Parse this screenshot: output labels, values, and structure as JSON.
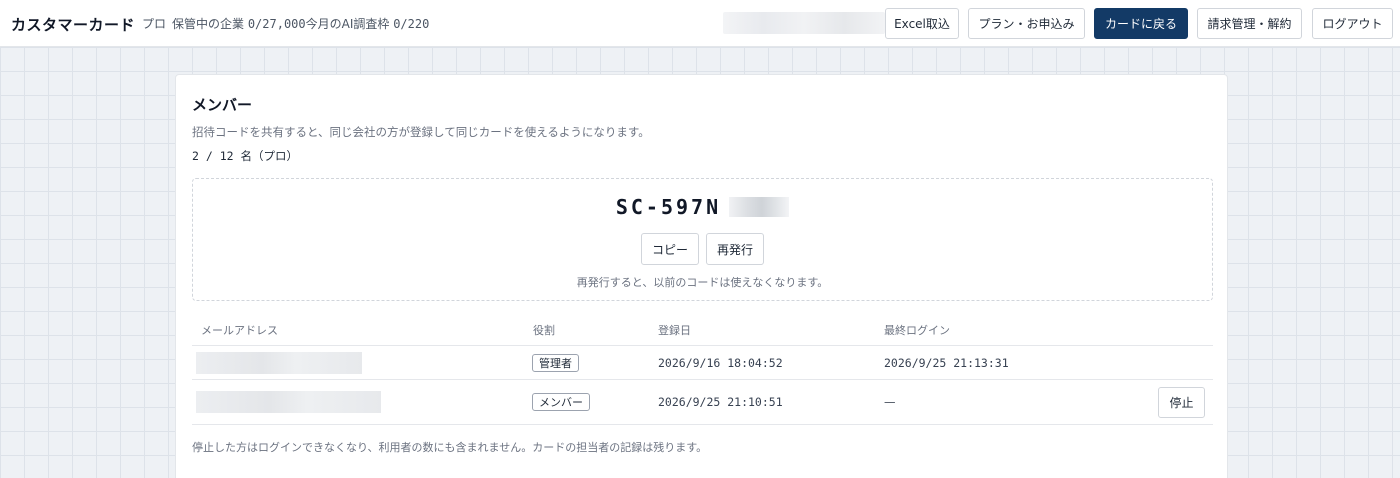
{
  "header": {
    "app_title": "カスタマーカード",
    "plan_label": "プロ",
    "usage_prefix": "保管中の企業 ",
    "usage_companies": "0/27,000",
    "usage_ai_label": "今月のAI調査枠 ",
    "usage_ai": "0/220",
    "buttons": {
      "excel_import": "Excel取込",
      "plan_apply": "プラン・お申込み",
      "back_to_card": "カードに戻る",
      "billing": "請求管理・解約",
      "logout": "ログアウト"
    },
    "primary_color": "#133a66"
  },
  "members": {
    "title": "メンバー",
    "description": "招待コードを共有すると、同じ会社の方が登録して同じカードを使えるようになります。",
    "count": "2 / 12 名（プロ）",
    "invite": {
      "code": "SC-597N",
      "copy_label": "コピー",
      "reissue_label": "再発行",
      "note": "再発行すると、以前のコードは使えなくなります。"
    },
    "table": {
      "headers": {
        "email": "メールアドレス",
        "role": "役割",
        "registered": "登録日",
        "last_login": "最終ログイン"
      },
      "rows": [
        {
          "role": "管理者",
          "registered": "2026/9/16 18:04:52",
          "last_login": "2026/9/25 21:13:31"
        },
        {
          "role": "メンバー",
          "registered": "2026/9/25 21:10:51",
          "last_login": "—",
          "action": "停止"
        }
      ]
    },
    "footnote": "停止した方はログインできなくなり、利用者の数にも含まれません。カードの担当者の記録は残ります。"
  }
}
